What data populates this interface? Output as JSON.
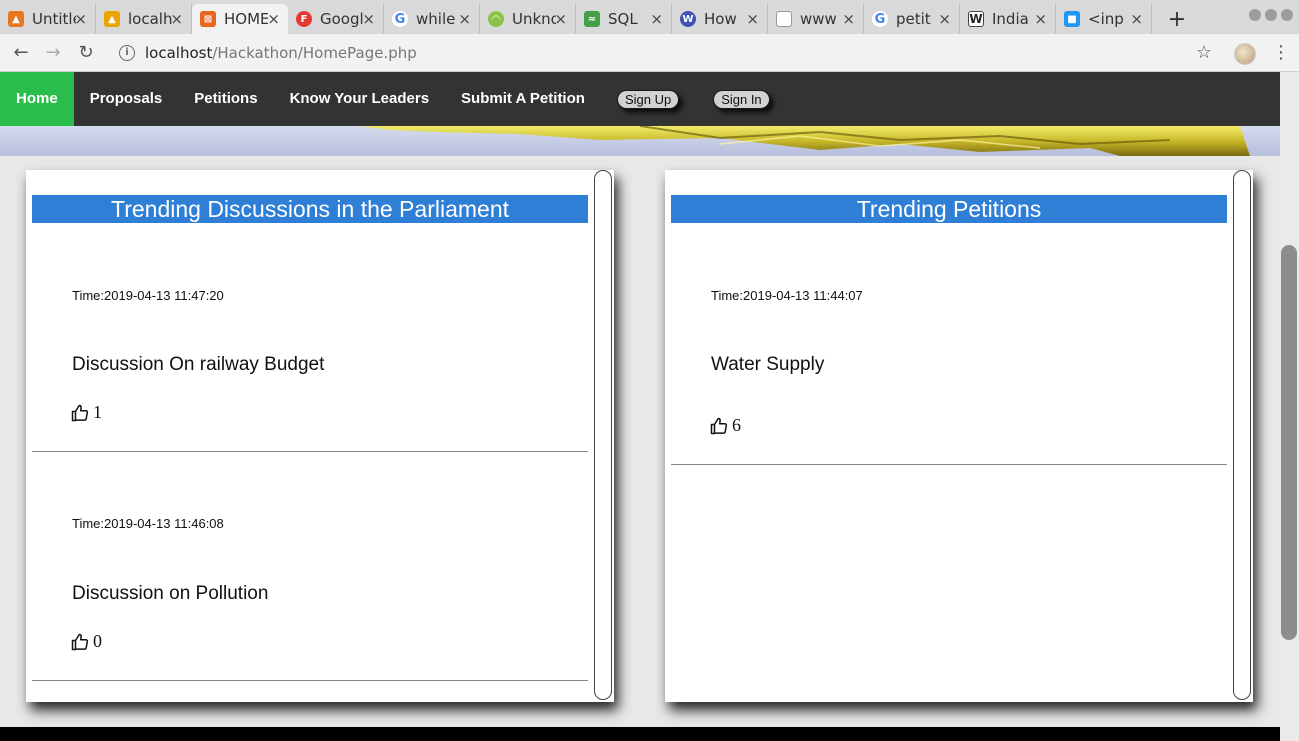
{
  "browser": {
    "tabs": [
      {
        "label": "Untitled",
        "icon": "app-icon",
        "color": "#e87722",
        "active": false
      },
      {
        "label": "localhost",
        "icon": "phpmyadmin-icon",
        "color": "#e8a400",
        "active": false
      },
      {
        "label": "HOME",
        "icon": "xampp-icon",
        "color": "#e8661e",
        "active": true
      },
      {
        "label": "Google",
        "icon": "google-forms-icon",
        "color": "#e53935",
        "active": false
      },
      {
        "label": "while",
        "icon": "google-icon",
        "color": "#4285f4",
        "active": false
      },
      {
        "label": "Unknown",
        "icon": "unknown-site-icon",
        "color": "#8bc34a",
        "active": false
      },
      {
        "label": "SQL",
        "icon": "sql-icon",
        "color": "#43a047",
        "active": false
      },
      {
        "label": "How",
        "icon": "w-icon",
        "color": "#3f51b5",
        "active": false
      },
      {
        "label": "www",
        "icon": "page-icon",
        "color": "#999999",
        "active": false
      },
      {
        "label": "petit",
        "icon": "google-icon",
        "color": "#4285f4",
        "active": false
      },
      {
        "label": "India",
        "icon": "wikipedia-icon",
        "color": "#222222",
        "active": false
      },
      {
        "label": "<inp",
        "icon": "page-icon",
        "color": "#2196f3",
        "active": false
      }
    ],
    "new_tab_label": "+",
    "url_host": "localhost",
    "url_path": "/Hackathon/HomePage.php"
  },
  "nav": {
    "items": [
      "Home",
      "Proposals",
      "Petitions",
      "Know Your Leaders",
      "Submit A Petition"
    ],
    "active": "Home",
    "sign_up": "Sign Up",
    "sign_in": "Sign In"
  },
  "discussions": {
    "title": "Trending Discussions in the Parliament",
    "items": [
      {
        "time": "Time:2019-04-13 11:47:20",
        "title": "Discussion On railway Budget",
        "likes": "1"
      },
      {
        "time": "Time:2019-04-13 11:46:08",
        "title": "Discussion on Pollution",
        "likes": "0"
      }
    ]
  },
  "petitions": {
    "title": "Trending Petitions",
    "items": [
      {
        "time": "Time:2019-04-13 11:44:07",
        "title": "Water Supply",
        "likes": "6"
      }
    ]
  },
  "colors": {
    "nav_bg": "#333333",
    "nav_active": "#2bbd4c",
    "card_header": "#2f7fd6"
  }
}
